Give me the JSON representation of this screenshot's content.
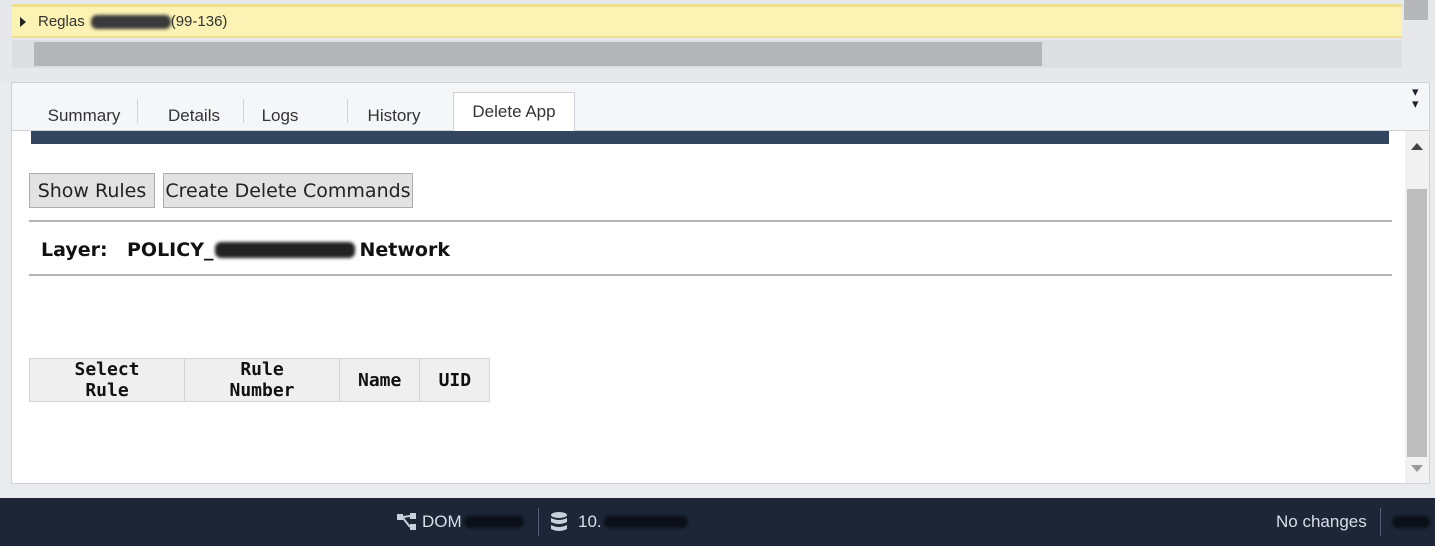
{
  "rule_group": {
    "label_prefix": "Reglas",
    "range": "(99-136)"
  },
  "tabs": [
    {
      "label": "Summary",
      "active": false
    },
    {
      "label": "Details",
      "active": false
    },
    {
      "label": "Logs",
      "active": false
    },
    {
      "label": "History",
      "active": false
    },
    {
      "label": "Delete App",
      "active": true
    }
  ],
  "toolbar": {
    "show_rules_label": "Show Rules",
    "create_delete_commands_label": "Create Delete Commands"
  },
  "layer": {
    "label": "Layer:",
    "value_prefix": "POLICY_",
    "value_suffix": "Network"
  },
  "rules_table": {
    "columns": [
      "Select Rule",
      "Rule Number",
      "Name",
      "UID"
    ],
    "rows": []
  },
  "statusbar": {
    "domain_prefix": "DOM",
    "server_prefix": "10.",
    "changes_text": "No changes"
  },
  "icons": {
    "expander": "triangle-right-icon",
    "collapse_panel": "double-chevron-down-icon",
    "domain": "network-topology-icon",
    "server": "database-icon"
  },
  "colors": {
    "rule_group_bg": "#fbf2b3",
    "banner": "#34455f",
    "statusbar_bg": "#1c2637"
  }
}
